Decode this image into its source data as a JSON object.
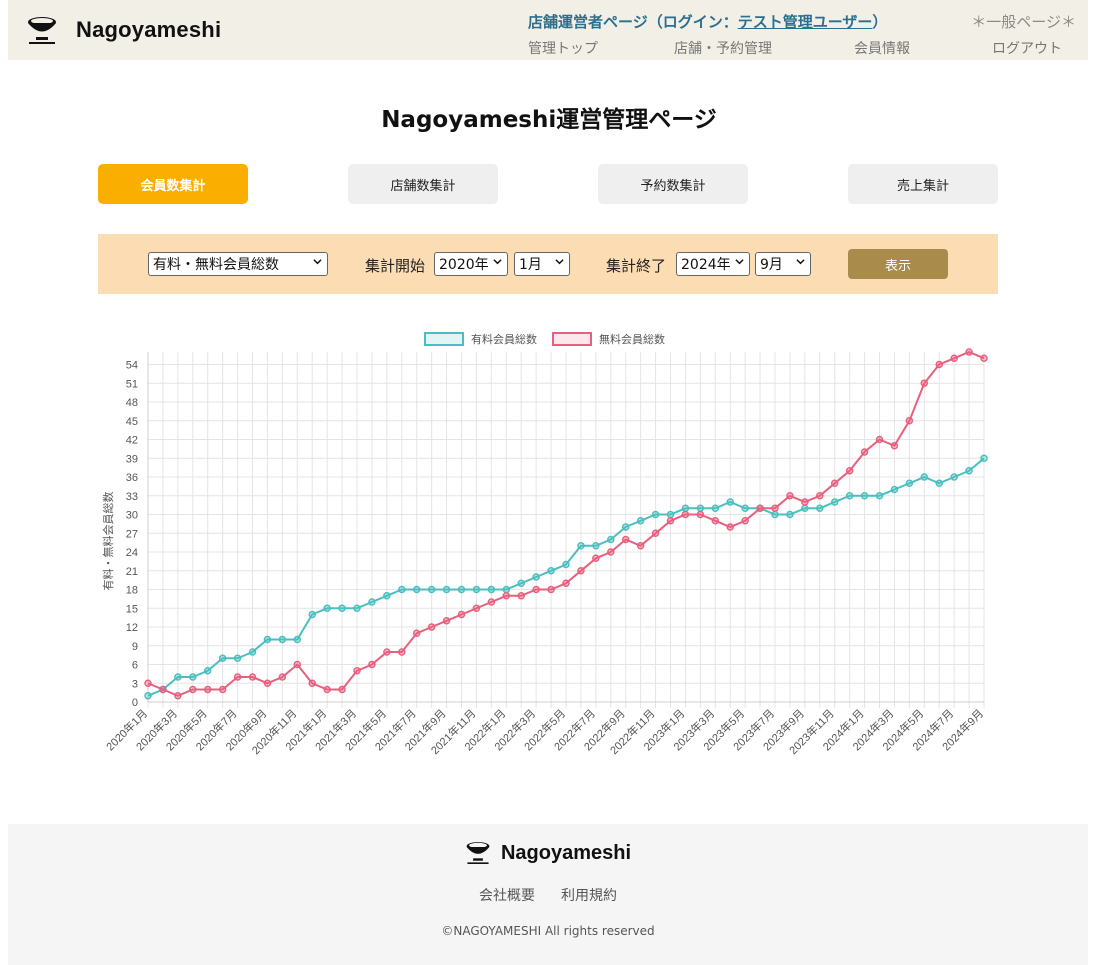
{
  "header": {
    "brand": "Nagoyameshi",
    "admin_prefix": "店舗運営者ページ（ログイン：",
    "admin_user": "テスト管理ユーザー",
    "admin_suffix": "）",
    "general_link": "＊一般ページ＊",
    "nav": [
      "管理トップ",
      "店舗・予約管理",
      "会員情報",
      "ログアウト"
    ]
  },
  "page_title": "Nagoyameshi運営管理ページ",
  "tabs": [
    {
      "label": "会員数集計",
      "active": true
    },
    {
      "label": "店舗数集計",
      "active": false
    },
    {
      "label": "予約数集計",
      "active": false
    },
    {
      "label": "売上集計",
      "active": false
    }
  ],
  "filter": {
    "type_value": "有料・無料会員総数",
    "start_label": "集計開始",
    "start_year": "2020年",
    "start_month": "1月",
    "end_label": "集計終了",
    "end_year": "2024年",
    "end_month": "9月",
    "show_button": "表示"
  },
  "chart_data": {
    "type": "line",
    "ylabel": "有料・無料会員総数",
    "ylim": [
      0,
      54
    ],
    "yticks": [
      0,
      3,
      6,
      9,
      12,
      15,
      18,
      21,
      24,
      27,
      30,
      33,
      36,
      39,
      42,
      45,
      48,
      51,
      54
    ],
    "grid": true,
    "legend_position": "top-center",
    "categories": [
      "2020年1月",
      "2020年2月",
      "2020年3月",
      "2020年4月",
      "2020年5月",
      "2020年6月",
      "2020年7月",
      "2020年8月",
      "2020年9月",
      "2020年10月",
      "2020年11月",
      "2020年12月",
      "2021年1月",
      "2021年2月",
      "2021年3月",
      "2021年4月",
      "2021年5月",
      "2021年6月",
      "2021年7月",
      "2021年8月",
      "2021年9月",
      "2021年10月",
      "2021年11月",
      "2021年12月",
      "2022年1月",
      "2022年2月",
      "2022年3月",
      "2022年4月",
      "2022年5月",
      "2022年6月",
      "2022年7月",
      "2022年8月",
      "2022年9月",
      "2022年10月",
      "2022年11月",
      "2022年12月",
      "2023年1月",
      "2023年2月",
      "2023年3月",
      "2023年4月",
      "2023年5月",
      "2023年6月",
      "2023年7月",
      "2023年8月",
      "2023年9月",
      "2023年10月",
      "2023年11月",
      "2023年12月",
      "2024年1月",
      "2024年2月",
      "2024年3月",
      "2024年4月",
      "2024年5月",
      "2024年6月",
      "2024年7月",
      "2024年8月",
      "2024年9月"
    ],
    "series": [
      {
        "name": "有料会員総数",
        "color": "#4bbfbf",
        "values": [
          1,
          2,
          4,
          4,
          5,
          7,
          7,
          8,
          10,
          10,
          10,
          14,
          15,
          15,
          15,
          16,
          17,
          18,
          18,
          18,
          18,
          18,
          18,
          18,
          18,
          19,
          20,
          21,
          22,
          25,
          25,
          26,
          28,
          29,
          30,
          30,
          31,
          31,
          31,
          32,
          31,
          31,
          30,
          30,
          31,
          31,
          32,
          33,
          33,
          33,
          34,
          35,
          36,
          35,
          36,
          37,
          39
        ]
      },
      {
        "name": "無料会員総数",
        "color": "#e9607f",
        "values": [
          3,
          2,
          1,
          2,
          2,
          2,
          4,
          4,
          3,
          4,
          6,
          3,
          2,
          2,
          5,
          6,
          8,
          8,
          11,
          12,
          13,
          14,
          15,
          16,
          17,
          17,
          18,
          18,
          19,
          21,
          23,
          24,
          26,
          25,
          27,
          29,
          30,
          30,
          29,
          28,
          29,
          31,
          31,
          33,
          32,
          33,
          35,
          37,
          40,
          42,
          41,
          45,
          51,
          54,
          55,
          56,
          55
        ]
      }
    ]
  },
  "footer": {
    "brand": "Nagoyameshi",
    "links": [
      "会社概要",
      "利用規約"
    ],
    "copyright": "©NAGOYAMESHI All rights reserved"
  }
}
